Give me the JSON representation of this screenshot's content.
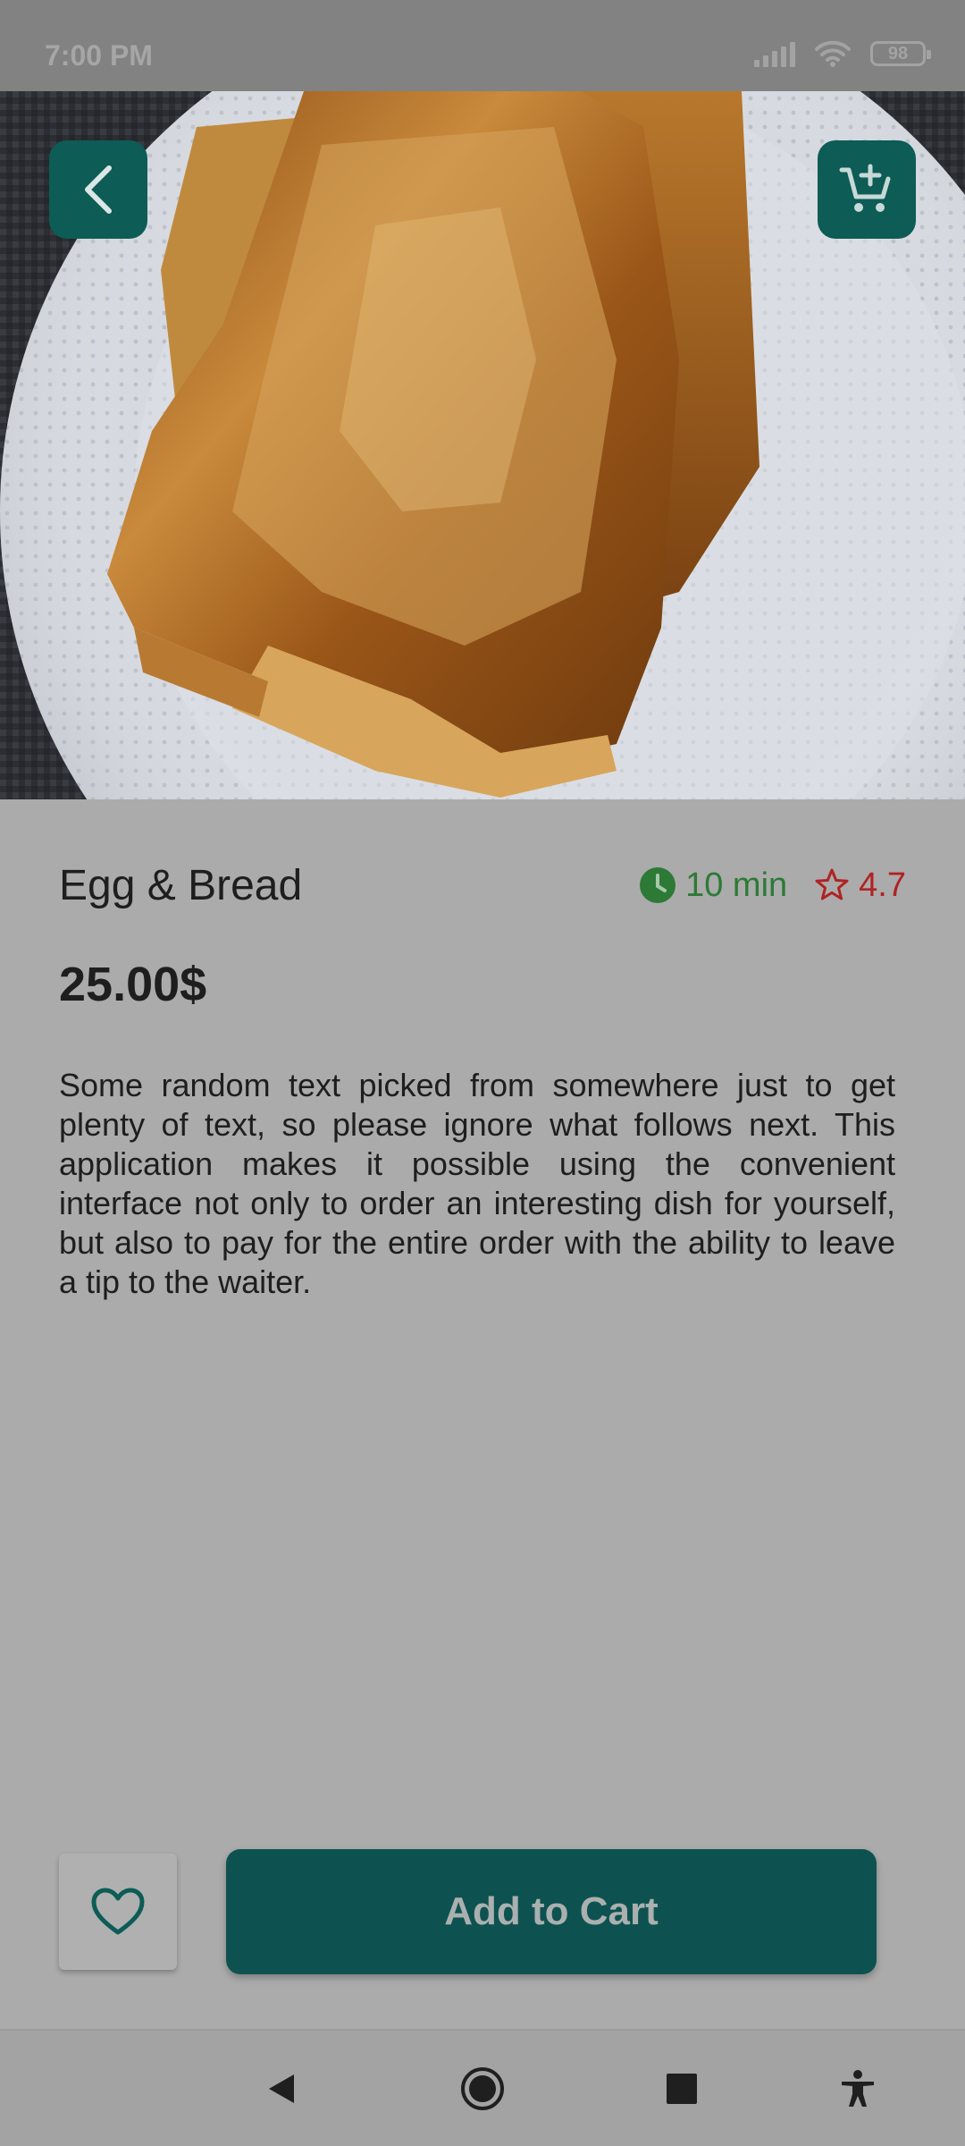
{
  "status_bar": {
    "time": "7:00 PM",
    "battery": "98"
  },
  "hero": {
    "image_description_icon": "french-toast-photo",
    "back_icon": "chevron-left-icon",
    "cart_icon": "add-to-cart-icon"
  },
  "product": {
    "title": "Egg & Bread",
    "time": "10 min",
    "rating": "4.7",
    "price": "25.00$",
    "description": "Some random text picked from somewhere just to get plenty of text, so please ignore what follows next. This application makes it possible using the convenient interface not only to order an interesting dish for yourself, but also to pay for the entire order with the ability to leave a tip to the waiter."
  },
  "actions": {
    "add_to_cart_label": "Add to Cart"
  },
  "colors": {
    "accent": "#0d5c56",
    "time_green": "#2d7a36",
    "rating_red": "#b02323"
  }
}
